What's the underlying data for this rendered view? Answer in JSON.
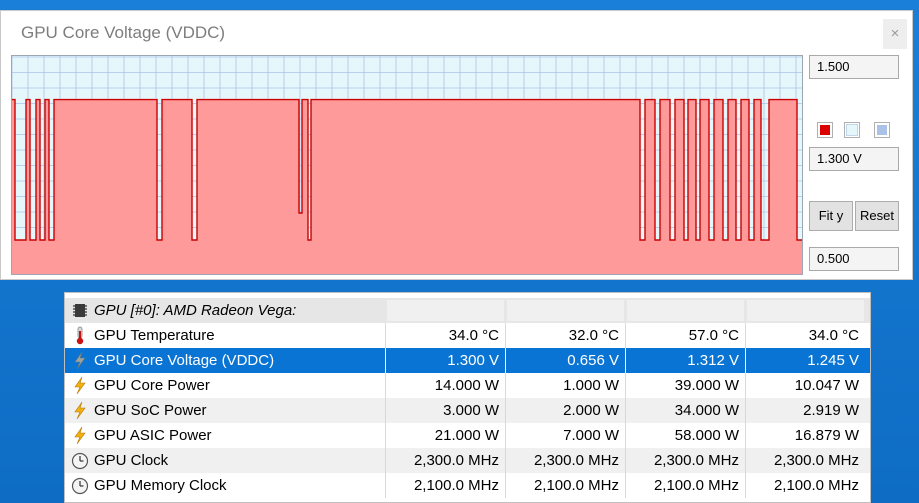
{
  "graph_window": {
    "title": "GPU Core Voltage (VDDC)",
    "close_label": "×",
    "y_max": "1.500",
    "current": "1.300 V",
    "y_min": "0.500",
    "fit_y_label": "Fit y",
    "reset_label": "Reset",
    "colors": {
      "line": "#cc0000",
      "fill": "#ff9a9a",
      "background": "#e6f7fb",
      "grid": "#a9c3e8"
    }
  },
  "chart_data": {
    "type": "area",
    "title": "GPU Core Voltage (VDDC)",
    "ylim": [
      0.5,
      1.5
    ],
    "units": "V",
    "grid": true,
    "levels": {
      "high": 1.3,
      "low": 0.656
    },
    "segments": [
      {
        "x0": 0,
        "x1": 3,
        "y": 1.3
      },
      {
        "x0": 3,
        "x1": 14,
        "y": 0.656
      },
      {
        "x0": 14,
        "x1": 18,
        "y": 1.3
      },
      {
        "x0": 18,
        "x1": 24,
        "y": 0.656
      },
      {
        "x0": 24,
        "x1": 28,
        "y": 1.3
      },
      {
        "x0": 28,
        "x1": 33,
        "y": 0.656
      },
      {
        "x0": 33,
        "x1": 37,
        "y": 1.3
      },
      {
        "x0": 37,
        "x1": 42,
        "y": 0.656
      },
      {
        "x0": 42,
        "x1": 145,
        "y": 1.3
      },
      {
        "x0": 145,
        "x1": 150,
        "y": 0.656
      },
      {
        "x0": 150,
        "x1": 180,
        "y": 1.3
      },
      {
        "x0": 180,
        "x1": 185,
        "y": 0.656
      },
      {
        "x0": 185,
        "x1": 287,
        "y": 1.3
      },
      {
        "x0": 287,
        "x1": 290,
        "y": 0.78
      },
      {
        "x0": 290,
        "x1": 296,
        "y": 1.3
      },
      {
        "x0": 296,
        "x1": 299,
        "y": 0.656
      },
      {
        "x0": 299,
        "x1": 628,
        "y": 1.3
      },
      {
        "x0": 628,
        "x1": 633,
        "y": 0.656
      },
      {
        "x0": 633,
        "x1": 643,
        "y": 1.3
      },
      {
        "x0": 643,
        "x1": 648,
        "y": 0.656
      },
      {
        "x0": 648,
        "x1": 658,
        "y": 1.3
      },
      {
        "x0": 658,
        "x1": 663,
        "y": 0.656
      },
      {
        "x0": 663,
        "x1": 672,
        "y": 1.3
      },
      {
        "x0": 672,
        "x1": 676,
        "y": 0.656
      },
      {
        "x0": 676,
        "x1": 684,
        "y": 1.3
      },
      {
        "x0": 684,
        "x1": 688,
        "y": 0.656
      },
      {
        "x0": 688,
        "x1": 697,
        "y": 1.3
      },
      {
        "x0": 697,
        "x1": 702,
        "y": 0.656
      },
      {
        "x0": 702,
        "x1": 711,
        "y": 1.3
      },
      {
        "x0": 711,
        "x1": 716,
        "y": 0.656
      },
      {
        "x0": 716,
        "x1": 724,
        "y": 1.3
      },
      {
        "x0": 724,
        "x1": 729,
        "y": 0.656
      },
      {
        "x0": 729,
        "x1": 737,
        "y": 1.3
      },
      {
        "x0": 737,
        "x1": 742,
        "y": 0.656
      },
      {
        "x0": 742,
        "x1": 749,
        "y": 1.3
      },
      {
        "x0": 749,
        "x1": 757,
        "y": 0.656
      },
      {
        "x0": 757,
        "x1": 762,
        "y": 1.3
      },
      {
        "x0": 762,
        "x1": 785,
        "y": 1.3
      },
      {
        "x0": 785,
        "x1": 790,
        "y": 0.656
      }
    ]
  },
  "sensors": {
    "header": "GPU [#0]: AMD Radeon Vega:",
    "rows": [
      {
        "icon": "thermometer-icon",
        "label": "GPU Temperature",
        "values": [
          "34.0 °C",
          "32.0 °C",
          "57.0 °C",
          "34.0 °C"
        ],
        "selected": false
      },
      {
        "icon": "voltage-bolt-icon",
        "label": "GPU Core Voltage (VDDC)",
        "values": [
          "1.300 V",
          "0.656 V",
          "1.312 V",
          "1.245 V"
        ],
        "selected": true
      },
      {
        "icon": "power-bolt-icon",
        "label": "GPU Core Power",
        "values": [
          "14.000 W",
          "1.000 W",
          "39.000 W",
          "10.047 W"
        ],
        "selected": false
      },
      {
        "icon": "power-bolt-icon",
        "label": "GPU SoC Power",
        "values": [
          "3.000 W",
          "2.000 W",
          "34.000 W",
          "2.919 W"
        ],
        "selected": false
      },
      {
        "icon": "power-bolt-icon",
        "label": "GPU ASIC Power",
        "values": [
          "21.000 W",
          "7.000 W",
          "58.000 W",
          "16.879 W"
        ],
        "selected": false
      },
      {
        "icon": "clock-icon",
        "label": "GPU Clock",
        "values": [
          "2,300.0 MHz",
          "2,300.0 MHz",
          "2,300.0 MHz",
          "2,300.0 MHz"
        ],
        "selected": false
      },
      {
        "icon": "clock-icon",
        "label": "GPU Memory Clock",
        "values": [
          "2,100.0 MHz",
          "2,100.0 MHz",
          "2,100.0 MHz",
          "2,100.0 MHz"
        ],
        "selected": false
      }
    ]
  }
}
